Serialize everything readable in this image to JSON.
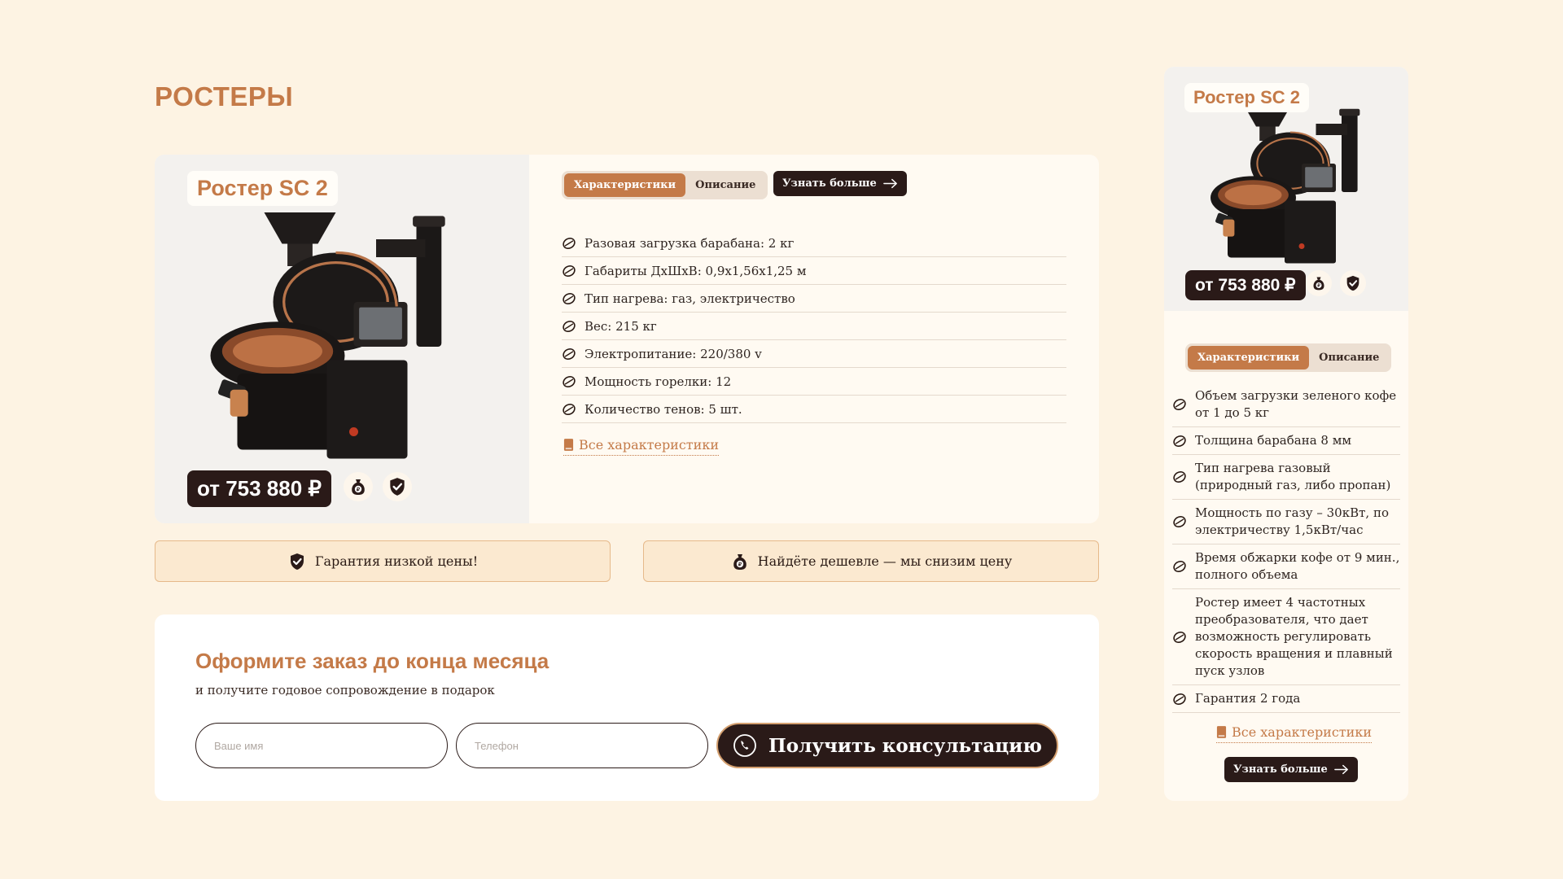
{
  "section_title": "РОСТЕРЫ",
  "main_product": {
    "name": "Ростер SC 2",
    "price": "от 753 880 ₽",
    "tabs": [
      "Характеристики",
      "Описание"
    ],
    "more_button": "Узнать больше",
    "specs": [
      "Разовая загрузка барабана: 2 кг",
      "Габариты ДхШхВ: 0,9х1,56х1,25 м",
      "Тип нагрева: газ, электричество",
      "Вес: 215 кг",
      "Электропитание: 220/380 v",
      "Мощность горелки: 12",
      "Количество тенов: 5 шт."
    ],
    "all_specs_link": "Все характеристики"
  },
  "guarantees": {
    "low_price": "Гарантия низкой цены!",
    "cheaper": "Найдёте дешевле — мы снизим цену"
  },
  "order_form": {
    "title": "Оформите заказ до конца месяца",
    "subtitle": "и получите годовое сопровождение в подарок",
    "name_placeholder": "Ваше имя",
    "phone_placeholder": "Телефон",
    "cta": "Получить консультацию"
  },
  "side_product": {
    "name": "Ростер SC 2",
    "price": "от 753 880 ₽",
    "tabs": [
      "Характеристики",
      "Описание"
    ],
    "specs": [
      "Объем загрузки зеленого кофе от 1 до 5 кг",
      "Толщина барабана 8 мм",
      "Тип нагрева газовый (природный газ, либо пропан)",
      "Мощность по газу – 30кВт, по электричеству 1,5кВт/час",
      "Время обжарки кофе от 9 мин., полного объема",
      "Ростер имеет 4 частотных преобразователя, что дает возможность регулировать скорость вращения и плавный пуск узлов",
      "Гарантия 2 года"
    ],
    "all_specs_link": "Все характеристики",
    "more_button": "Узнать больше"
  },
  "colors": {
    "background": "#fdf3e3",
    "accent": "#c47a48",
    "dark": "#2a1a18"
  },
  "icons": [
    "coffee-bean-icon",
    "money-bag-icon",
    "shield-check-icon",
    "book-icon",
    "arrow-right-icon",
    "phone-icon"
  ]
}
